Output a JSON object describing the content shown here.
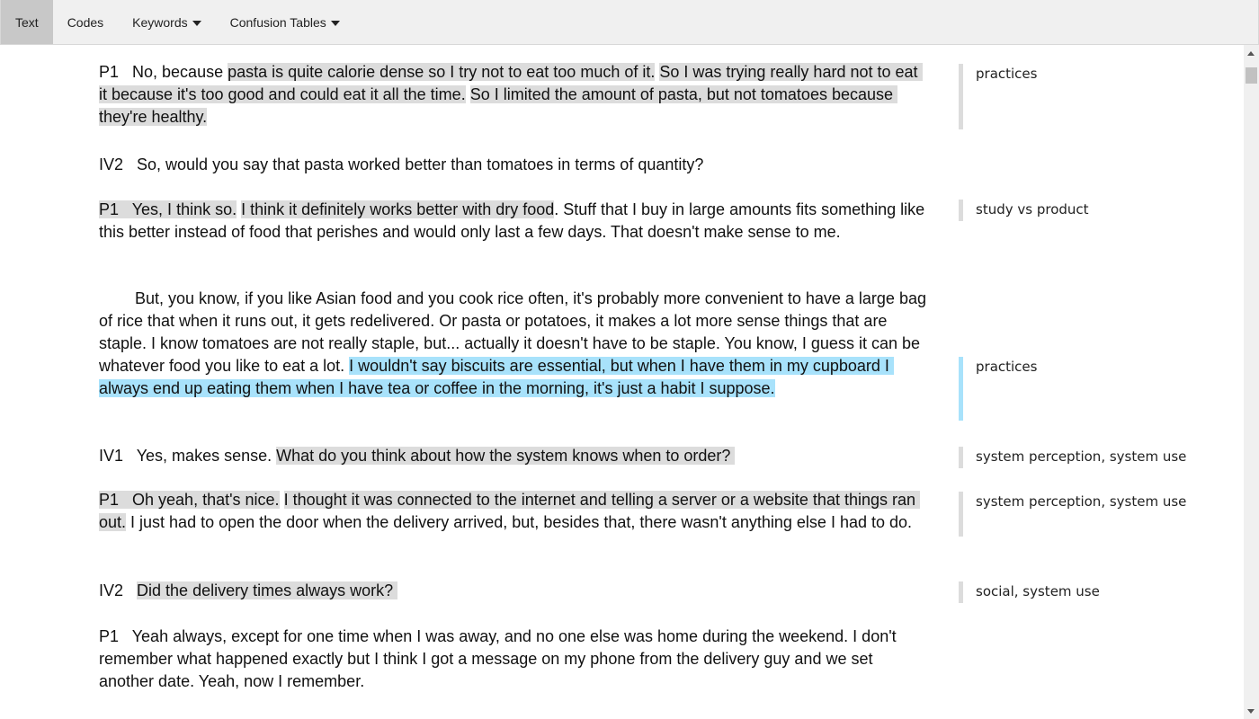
{
  "nav": {
    "items": [
      {
        "label": "Text",
        "active": true,
        "dropdown": false
      },
      {
        "label": "Codes",
        "active": false,
        "dropdown": false
      },
      {
        "label": "Keywords",
        "active": false,
        "dropdown": true
      },
      {
        "label": "Confusion Tables",
        "active": false,
        "dropdown": true
      }
    ]
  },
  "transcript": [
    {
      "segments": [
        {
          "text": "P1   No, because ",
          "hl": ""
        },
        {
          "text": "pasta is quite calorie dense so I try not to eat too much of it.",
          "hl": "gray"
        },
        {
          "text": " ",
          "hl": ""
        },
        {
          "text": "So I was trying really hard not to eat it because it's too good and could eat it all the time.",
          "hl": "gray"
        },
        {
          "text": " ",
          "hl": ""
        },
        {
          "text": "So I limited the amount of pasta, but not tomatoes because they're healthy.",
          "hl": "gray"
        }
      ]
    },
    {
      "segments": [
        {
          "text": "IV2   So, would you say that pasta worked better than tomatoes in terms of quantity?",
          "hl": ""
        }
      ]
    },
    {
      "segments": [
        {
          "text": "P1   Yes, I think so.",
          "hl": "gray"
        },
        {
          "text": " ",
          "hl": ""
        },
        {
          "text": "I think it definitely works better with dry food",
          "hl": "gray"
        },
        {
          "text": ". Stuff that I buy in large amounts fits something like this better instead of food that perishes and would only last a few days. That doesn't make sense to me.",
          "hl": ""
        }
      ]
    },
    {
      "indent": true,
      "segments": [
        {
          "text": "But, you know, if you like Asian food and you cook rice often, it's probably more convenient to have a large bag of rice that when it runs out, it gets redelivered. Or pasta or potatoes, it makes a lot more sense things that are staple. I know tomatoes are not really staple, but... actually it doesn't have to be staple. You know, I guess it can be whatever food you like to eat a lot. ",
          "hl": ""
        },
        {
          "text": "I wouldn't say biscuits are essential, but when I have them in my cupboard I always end up eating them when I have tea or coffee in the morning, it's just a habit I suppose.",
          "hl": "blue"
        }
      ]
    },
    {
      "segments": [
        {
          "text": "IV1   Yes, makes sense. ",
          "hl": ""
        },
        {
          "text": "What do you think about how the system knows when to order? ",
          "hl": "gray"
        }
      ]
    },
    {
      "segments": [
        {
          "text": "P1   Oh yeah, that's nice.",
          "hl": "gray"
        },
        {
          "text": " ",
          "hl": ""
        },
        {
          "text": "I thought it was connected to the internet and telling a server or a website that things ran out.",
          "hl": "gray"
        },
        {
          "text": " I just had to open the door when the delivery arrived, but, besides that, there wasn't anything else I had to do.",
          "hl": ""
        }
      ]
    },
    {
      "segments": [
        {
          "text": "IV2   ",
          "hl": ""
        },
        {
          "text": "Did the delivery times always work? ",
          "hl": "gray"
        }
      ]
    },
    {
      "segments": [
        {
          "text": "P1   Yeah always, except for one time when I was away, and no one else was home during the weekend. I don't remember what happened exactly but I think I got a message on my phone from the delivery guy and we set another date. Yeah, now I remember.",
          "hl": ""
        }
      ]
    }
  ],
  "codes": [
    {
      "label": "practices",
      "color": "gray"
    },
    {
      "label": "study vs product",
      "color": "gray"
    },
    {
      "label": "practices",
      "color": "blue"
    },
    {
      "label": "system perception, system use",
      "color": "gray"
    },
    {
      "label": "system perception, system use",
      "color": "gray"
    },
    {
      "label": "social, system use",
      "color": "gray"
    }
  ],
  "colors": {
    "highlight_gray": "#dcdcdc",
    "highlight_blue": "#a8e2fb",
    "nav_active": "#c8c8c8",
    "nav_bg": "#f0f0f0"
  }
}
